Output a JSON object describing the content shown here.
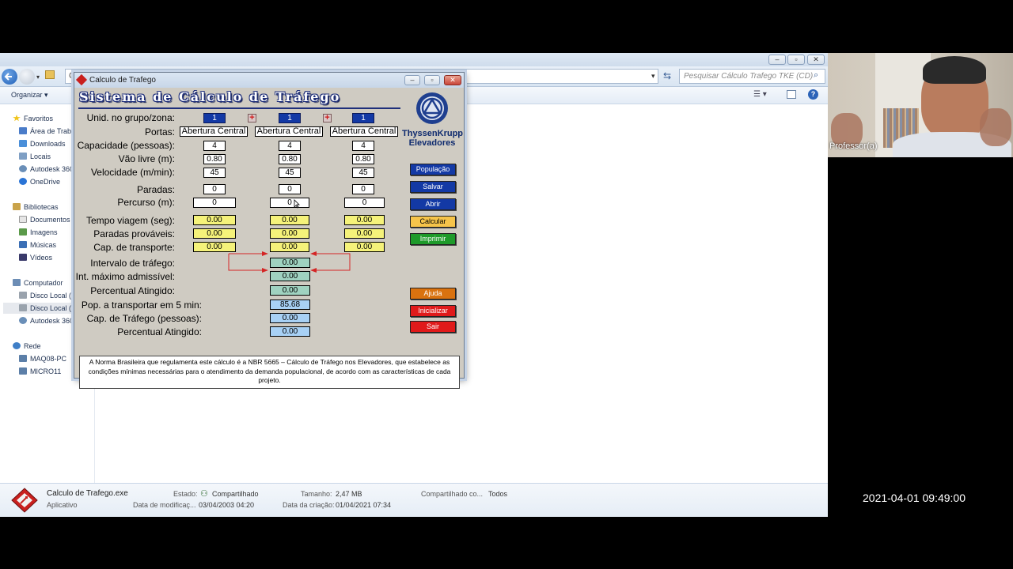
{
  "explorer": {
    "address_text": "C",
    "search_placeholder": "Pesquisar Cálculo Trafego TKE (CD)",
    "organize_label": "Organizar ▾",
    "sidebar": [
      {
        "label": "Favoritos",
        "type": "header"
      },
      {
        "label": "Área de Traba",
        "type": "item"
      },
      {
        "label": "Downloads",
        "type": "item"
      },
      {
        "label": "Locais",
        "type": "item"
      },
      {
        "label": "Autodesk 360",
        "type": "item"
      },
      {
        "label": "OneDrive",
        "type": "item"
      },
      {
        "label": "Bibliotecas",
        "type": "header"
      },
      {
        "label": "Documentos",
        "type": "item"
      },
      {
        "label": "Imagens",
        "type": "item"
      },
      {
        "label": "Músicas",
        "type": "item"
      },
      {
        "label": "Vídeos",
        "type": "item"
      },
      {
        "label": "Computador",
        "type": "header"
      },
      {
        "label": "Disco Local (C",
        "type": "item"
      },
      {
        "label": "Disco Local (D",
        "type": "item"
      },
      {
        "label": "Autodesk 360",
        "type": "item"
      },
      {
        "label": "Rede",
        "type": "header"
      },
      {
        "label": "MAQ08-PC",
        "type": "item"
      },
      {
        "label": "MICRO11",
        "type": "item"
      }
    ],
    "status": {
      "filename": "Calculo de Trafego.exe",
      "filetype": "Aplicativo",
      "estado_label": "Estado:",
      "estado_value": "Compartilhado",
      "tamanho_label": "Tamanho:",
      "tamanho_value": "2,47 MB",
      "compartilhado_label": "Compartilhado co...",
      "compartilhado_value": "Todos",
      "modificacao_label": "Data de modificaç...",
      "modificacao_value": "03/04/2003 04:20",
      "criacao_label": "Data da criação:",
      "criacao_value": "01/04/2021 07:34"
    }
  },
  "dialog": {
    "title": "Calculo de Trafego",
    "heading": "Sistema de Cálculo de Tráfego",
    "brand": {
      "line1": "ThyssenKrupp",
      "line2": "Elevadores"
    },
    "labels": {
      "unid": "Unid. no grupo/zona:",
      "portas": "Portas:",
      "capacidade": "Capacidade (pessoas):",
      "vao": "Vão livre (m):",
      "velocidade": "Velocidade (m/min):",
      "paradas": "Paradas:",
      "percurso": "Percurso (m):",
      "tempo": "Tempo viagem (seg):",
      "paradas_provaveis": "Paradas prováveis:",
      "cap_transporte": "Cap. de transporte:",
      "intervalo": "Intervalo de tráfego:",
      "int_maximo": "Int. máximo admissível:",
      "percentual1": "Percentual Atingido:",
      "pop5": "Pop. a  transportar em 5 min:",
      "cap_trafego": "Cap. de Tráfego (pessoas):",
      "percentual2": "Percentual Atingido:"
    },
    "plus_symbol": "+",
    "columns": [
      {
        "unid": "1",
        "portas": "Abertura Central",
        "capacidade": "4",
        "vao": "0.80",
        "velocidade": "45",
        "paradas": "0",
        "percurso": "0",
        "tempo": "0.00",
        "paradas_prov": "0.00",
        "cap_transp": "0.00"
      },
      {
        "unid": "1",
        "portas": "Abertura Central",
        "capacidade": "4",
        "vao": "0.80",
        "velocidade": "45",
        "paradas": "0",
        "percurso": "0",
        "tempo": "0.00",
        "paradas_prov": "0.00",
        "cap_transp": "0.00"
      },
      {
        "unid": "1",
        "portas": "Abertura Central",
        "capacidade": "4",
        "vao": "0.80",
        "velocidade": "45",
        "paradas": "0",
        "percurso": "0",
        "tempo": "0.00",
        "paradas_prov": "0.00",
        "cap_transp": "0.00"
      }
    ],
    "results": {
      "intervalo": "0.00",
      "int_maximo": "0.00",
      "percentual1": "0.00",
      "pop5": "85.68",
      "cap_trafego": "0.00",
      "percentual2": "0.00"
    },
    "buttons": {
      "populacao": "População",
      "salvar": "Salvar",
      "abrir": "Abrir",
      "calcular": "Calcular",
      "imprimir": "Imprimir",
      "ajuda": "Ajuda",
      "inicializar": "Inicializar",
      "sair": "Sair"
    },
    "note": "A Norma Brasileira que regulamenta este cálculo é a NBR 5665 – Cálculo de Tráfego nos Elevadores, que estabelece as condições mínimas necessárias para o atendimento da demanda populacional, de acordo com as características de cada projeto."
  },
  "webcam": {
    "name": "Professor(a)"
  },
  "timestamp": "2021-04-01  09:49:00",
  "colors": {
    "navy_button": "#1339a5",
    "calc_button": "#f6c44a",
    "print_button": "#1e9a2a",
    "help_button": "#d9720f",
    "exit_button": "#e01a1a",
    "heading": "#1f2f7a"
  }
}
